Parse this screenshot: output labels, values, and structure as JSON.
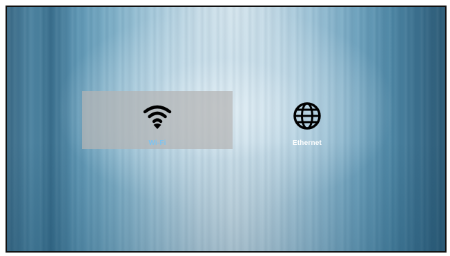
{
  "network_options": [
    {
      "label": "Wi-Fi",
      "icon": "wifi-icon",
      "selected": true
    },
    {
      "label": "Ethernet",
      "icon": "globe-icon",
      "selected": false
    }
  ],
  "colors": {
    "selected_label": "#7fc3ee",
    "label": "#ffffff",
    "icon": "#000000",
    "selected_tile_bg": "#b4b4b4"
  }
}
